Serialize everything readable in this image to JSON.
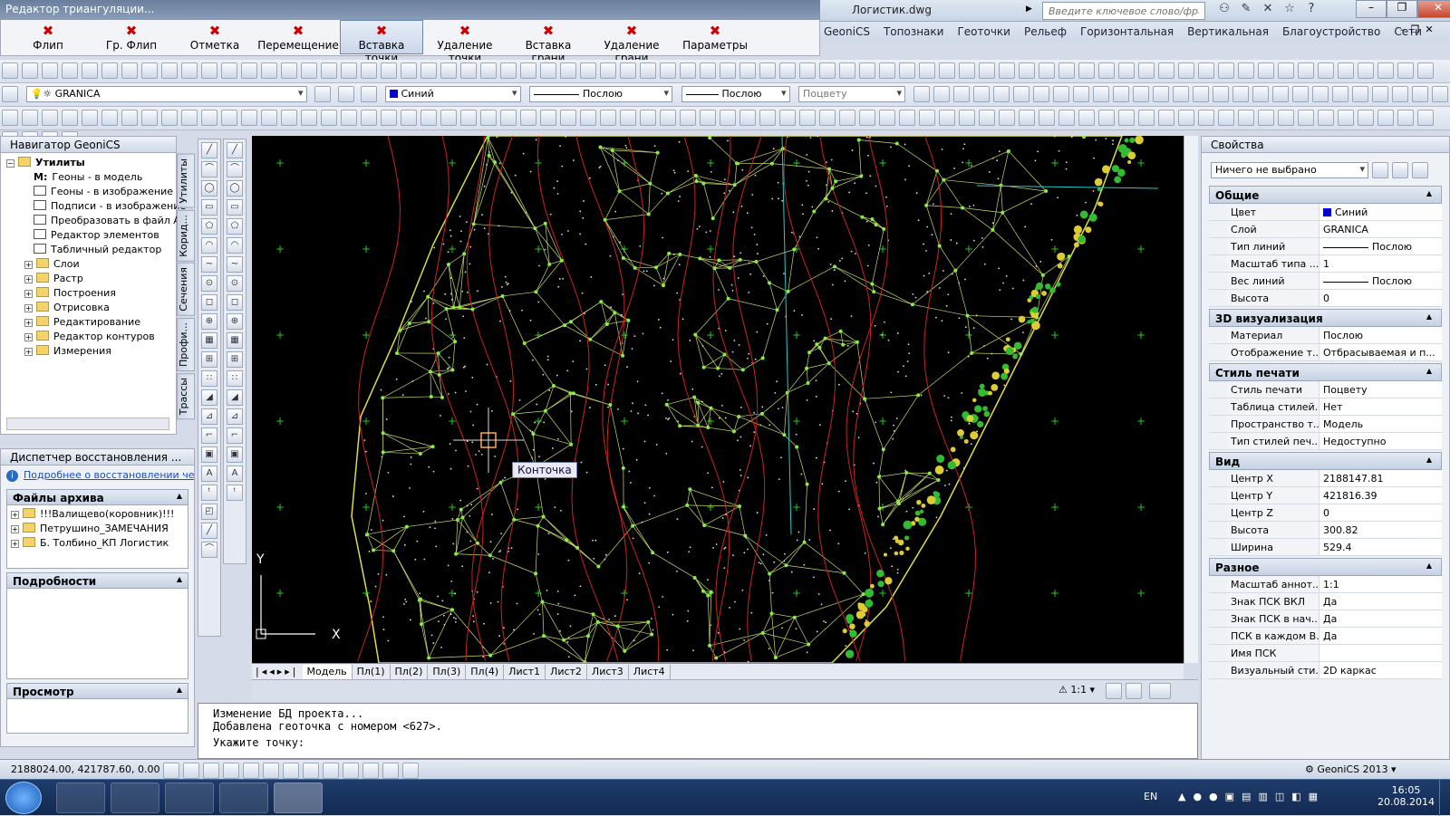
{
  "window": {
    "triangulation_title": "Редактор триангуляции...",
    "filename": "Логистик.dwg",
    "search_placeholder": "Введите ключевое слово/фразу"
  },
  "tri_toolbar": [
    {
      "label": "Флип",
      "icon": "flip-icon"
    },
    {
      "label": "Гр. Флип",
      "icon": "group-flip-icon"
    },
    {
      "label": "Отметка",
      "icon": "elevation-icon"
    },
    {
      "label": "Перемещение",
      "icon": "move-point-icon"
    },
    {
      "label": "Вставка точки",
      "icon": "insert-point-icon",
      "active": true
    },
    {
      "label": "Удаление точки",
      "icon": "delete-point-icon"
    },
    {
      "label": "Вставка грани",
      "icon": "insert-edge-icon"
    },
    {
      "label": "Удаление грани",
      "icon": "delete-edge-icon"
    },
    {
      "label": "Параметры",
      "icon": "parameters-icon"
    }
  ],
  "menu": [
    "GeoniCS",
    "Топознаки",
    "Геоточки",
    "Рельеф",
    "Горизонтальная",
    "Вертикальная",
    "Благоустройство",
    "Сети"
  ],
  "layer_toolbar": {
    "layer": "GRANICA",
    "color": "Синий",
    "color_hex": "#0000cc",
    "linetype": "Послою",
    "lineweight": "Послою",
    "plotstyle": "Поцвету"
  },
  "navigator": {
    "title": "Навигатор GeoniCS",
    "root": "Утилиты",
    "tools": [
      "Геоны - в модель",
      "Геоны - в изображение",
      "Подписи - в изображение",
      "Преобразовать в файл A",
      "Редактор элементов",
      "Табличный редактор"
    ],
    "tool_prefix": "M:",
    "folders": [
      "Слои",
      "Растр",
      "Построения",
      "Отрисовка",
      "Редактирование",
      "Редактор контуров",
      "Измерения"
    ]
  },
  "vtabs": [
    "Утилиты",
    "Корид...",
    "Сечения",
    "Профи...",
    "Трассы"
  ],
  "recovery": {
    "title": "Диспетчер восстановления ...",
    "link": "Подробнее о восстановлении че",
    "files_head": "Файлы архива",
    "files": [
      "!!!Валищево(коровник)!!!",
      "Петрушино_ЗАМЕЧАНИЯ",
      "Б. Толбино_КП Логистик"
    ],
    "details_head": "Подробности",
    "preview_head": "Просмотр"
  },
  "canvas": {
    "tooltip": "Конточка",
    "ucs_x": "X",
    "ucs_y": "Y"
  },
  "layout_tabs": [
    "Модель",
    "Пл(1)",
    "Пл(2)",
    "Пл(3)",
    "Пл(4)",
    "Лист1",
    "Лист2",
    "Лист3",
    "Лист4"
  ],
  "scale": "1:1",
  "command_lines": [
    "Изменение БД проекта...",
    "Добавлена геоточка  с номером <627>.",
    "Укажите точку:"
  ],
  "status": {
    "coords": "2188024.00, 421787.60, 0.00",
    "workspace": "GeoniCS 2013"
  },
  "properties": {
    "title": "Свойства",
    "selection": "Ничего не выбрано",
    "groups": [
      {
        "name": "Общие",
        "rows": [
          [
            "Цвет",
            "Синий"
          ],
          [
            "Слой",
            "GRANICA"
          ],
          [
            "Тип линий",
            "Послою"
          ],
          [
            "Масштаб типа ...",
            "1"
          ],
          [
            "Вес линий",
            "Послою"
          ],
          [
            "Высота",
            "0"
          ]
        ]
      },
      {
        "name": "3D визуализация",
        "rows": [
          [
            "Материал",
            "Послою"
          ],
          [
            "Отображение т...",
            "Отбрасываемая и п..."
          ]
        ]
      },
      {
        "name": "Стиль печати",
        "rows": [
          [
            "Стиль печати",
            "Поцвету"
          ],
          [
            "Таблица стилей...",
            "Нет"
          ],
          [
            "Пространство т...",
            "Модель"
          ],
          [
            "Тип стилей печ...",
            "Недоступно"
          ]
        ]
      },
      {
        "name": "Вид",
        "rows": [
          [
            "Центр X",
            "2188147.81"
          ],
          [
            "Центр Y",
            "421816.39"
          ],
          [
            "Центр Z",
            "0"
          ],
          [
            "Высота",
            "300.82"
          ],
          [
            "Ширина",
            "529.4"
          ]
        ]
      },
      {
        "name": "Разное",
        "rows": [
          [
            "Масштаб аннот...",
            "1:1"
          ],
          [
            "Знак ПСК ВКЛ",
            "Да"
          ],
          [
            "Знак ПСК в нач...",
            "Да"
          ],
          [
            "ПСК в каждом В...",
            "Да"
          ],
          [
            "Имя ПСК",
            ""
          ],
          [
            "Визуальный сти...",
            "2D каркас"
          ]
        ]
      }
    ]
  },
  "taskbar": {
    "lang": "EN",
    "time": "16:05",
    "date": "20.08.2014"
  }
}
